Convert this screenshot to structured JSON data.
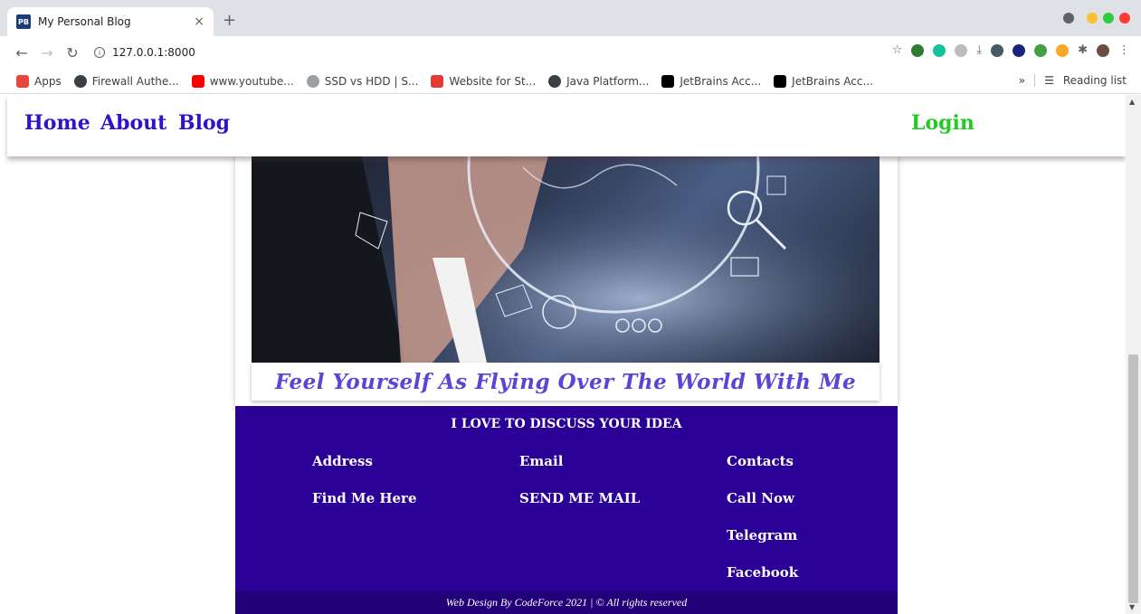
{
  "browser": {
    "tab_title": "My Personal Blog",
    "favicon_text": "PB",
    "tab_close": "×",
    "new_tab": "+",
    "url": "127.0.0.1:8000",
    "bookmarks": [
      {
        "label": "Apps",
        "icon": "apps-grid-icon",
        "color": "#e8453c"
      },
      {
        "label": "Firewall Authe...",
        "icon": "globe-icon",
        "color": "#3c4043"
      },
      {
        "label": "www.youtube...",
        "icon": "youtube-icon",
        "color": "#ff0000"
      },
      {
        "label": "SSD vs HDD | S...",
        "icon": "site-icon",
        "color": "#9aa0a6"
      },
      {
        "label": "Website for St...",
        "icon": "w-logo-icon",
        "color": "#e53935"
      },
      {
        "label": "Java Platform...",
        "icon": "globe-icon",
        "color": "#3c4043"
      },
      {
        "label": "JetBrains Acc...",
        "icon": "jetbrains-icon",
        "color": "#000000"
      },
      {
        "label": "JetBrains Acc...",
        "icon": "jetbrains-icon",
        "color": "#000000"
      }
    ],
    "more_bookmarks": "»",
    "reading_list": "Reading list"
  },
  "nav": {
    "links": [
      "Home",
      "About",
      "Blog"
    ],
    "login": "Login"
  },
  "hero": {
    "caption": "Feel Yourself As Flying Over The World With Me"
  },
  "footer": {
    "title": "I LOVE TO DISCUSS YOUR IDEA",
    "col1": [
      "Address",
      "Find Me Here"
    ],
    "col2": [
      "Email",
      "SEND ME MAIL"
    ],
    "col3": [
      "Contacts",
      "Call Now",
      "Telegram",
      "Facebook"
    ],
    "copyright": "Web Design By CodeForce 2021 | © All rights reserved"
  },
  "colors": {
    "nav_link": "#3311cc",
    "login": "#22cc22",
    "footer_bg": "#2a0096",
    "caption": "#5a45d6"
  }
}
